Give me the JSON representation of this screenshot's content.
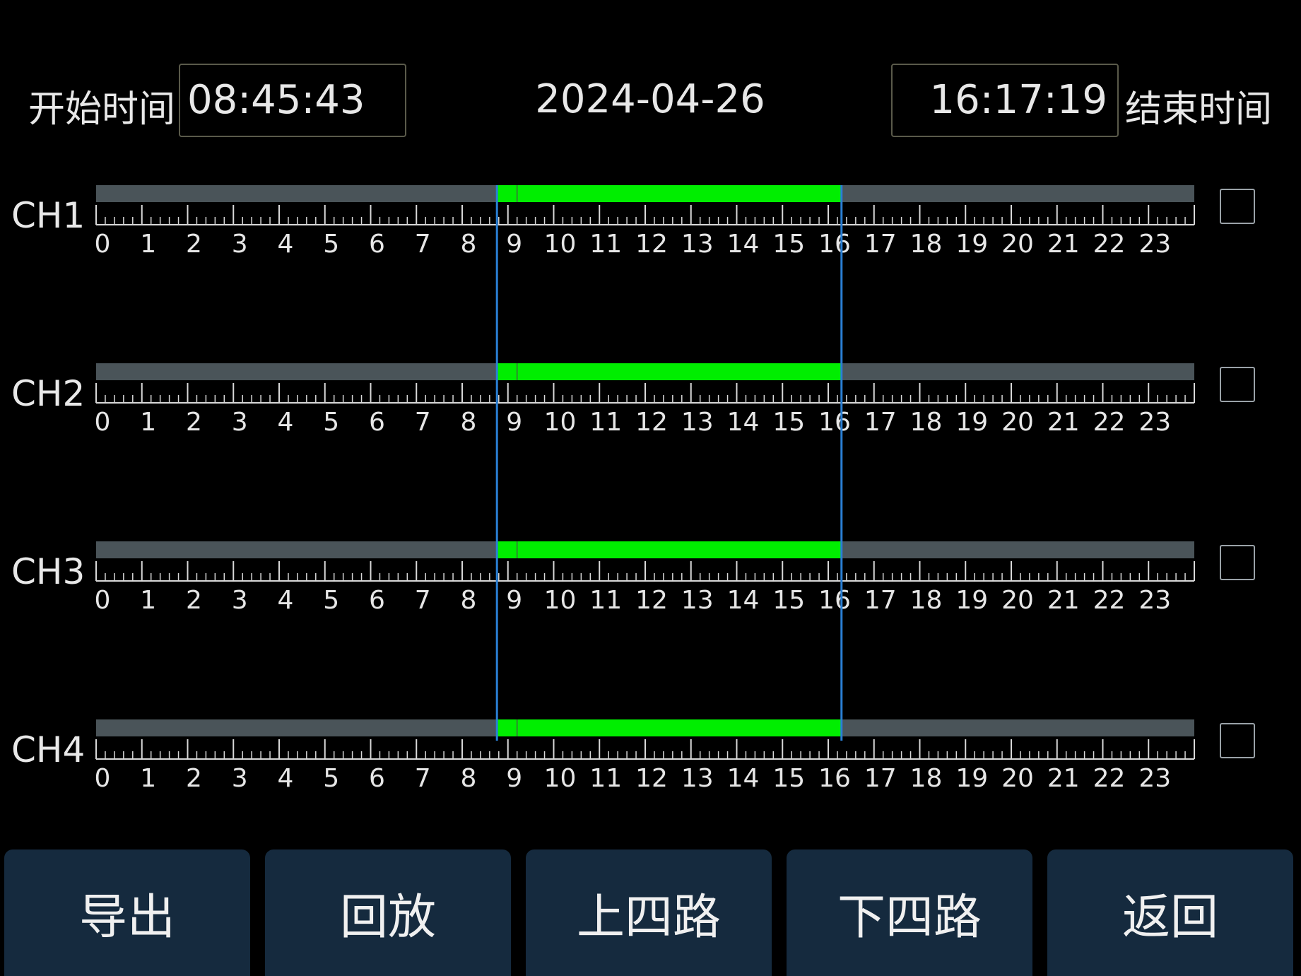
{
  "header": {
    "start_label": "开始时间",
    "start_time": "08:45:43",
    "date": "2024-04-26",
    "end_time": "16:17:19",
    "end_label": "结束时间"
  },
  "channels": [
    {
      "label": "CH1",
      "recording_start_hour": 8.76,
      "recording_end_hour": 16.29,
      "checked": false
    },
    {
      "label": "CH2",
      "recording_start_hour": 8.76,
      "recording_end_hour": 16.29,
      "checked": false
    },
    {
      "label": "CH3",
      "recording_start_hour": 8.76,
      "recording_end_hour": 16.29,
      "checked": false
    },
    {
      "label": "CH4",
      "recording_start_hour": 8.76,
      "recording_end_hour": 16.29,
      "checked": false
    }
  ],
  "timeline": {
    "hours": [
      "0",
      "1",
      "2",
      "3",
      "4",
      "5",
      "6",
      "7",
      "8",
      "9",
      "10",
      "11",
      "12",
      "13",
      "14",
      "15",
      "16",
      "17",
      "18",
      "19",
      "20",
      "21",
      "22",
      "23"
    ],
    "range_hours": [
      0,
      24
    ],
    "minor_ticks_per_hour": 5,
    "selection_start_hour": 8.76,
    "selection_end_hour": 16.29
  },
  "colors": {
    "background": "#000000",
    "track": "#4a5459",
    "recording": "#00ee00",
    "ruler": "#d8d8d8",
    "selection_line": "#2a7fd4",
    "button_bg": "#152a3e"
  },
  "buttons": {
    "export": "导出",
    "playback": "回放",
    "prev_four": "上四路",
    "next_four": "下四路",
    "back": "返回"
  }
}
